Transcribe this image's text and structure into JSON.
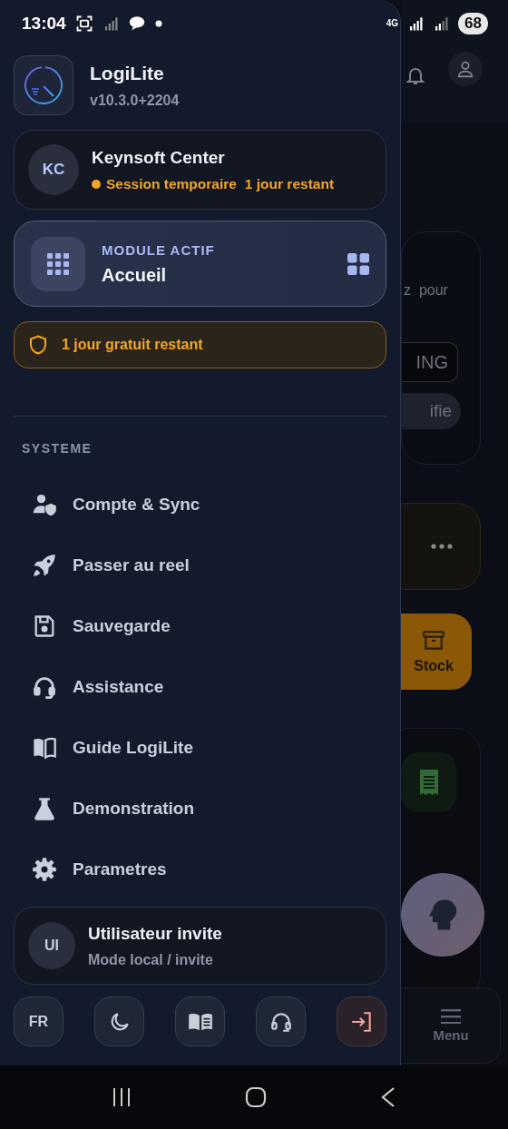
{
  "status_bar": {
    "time": "13:04",
    "network": "4G",
    "battery": "68"
  },
  "app": {
    "name": "LogiLite",
    "version": "v10.3.0+2204"
  },
  "account": {
    "initials": "KC",
    "name": "Keynsoft Center",
    "status": "Session temporaire",
    "remaining": "1 jour restant",
    "color": "#f5a623"
  },
  "module": {
    "label": "MODULE ACTIF",
    "name": "Accueil"
  },
  "trial_banner": {
    "text": "1 jour gratuit restant"
  },
  "section": {
    "title": "SYSTEME",
    "items": [
      {
        "kind": "account",
        "label": "Compte & Sync"
      },
      {
        "kind": "rocket",
        "label": "Passer au reel"
      },
      {
        "kind": "save",
        "label": "Sauvegarde"
      },
      {
        "kind": "support",
        "label": "Assistance"
      },
      {
        "kind": "guide",
        "label": "Guide LogiLite"
      },
      {
        "kind": "demo",
        "label": "Demonstration"
      },
      {
        "kind": "settings",
        "label": "Parametres"
      }
    ]
  },
  "user": {
    "initials": "UI",
    "name": "Utilisateur invite",
    "mode": "Mode local / invite"
  },
  "quick_actions": [
    {
      "kind": "language",
      "label": "FR"
    },
    {
      "kind": "theme"
    },
    {
      "kind": "guide"
    },
    {
      "kind": "support"
    },
    {
      "kind": "logout"
    }
  ],
  "background": {
    "card_text": "z  pour",
    "code": "ING",
    "pill": "ifie",
    "stock": "Stock",
    "menu": "Menu"
  }
}
